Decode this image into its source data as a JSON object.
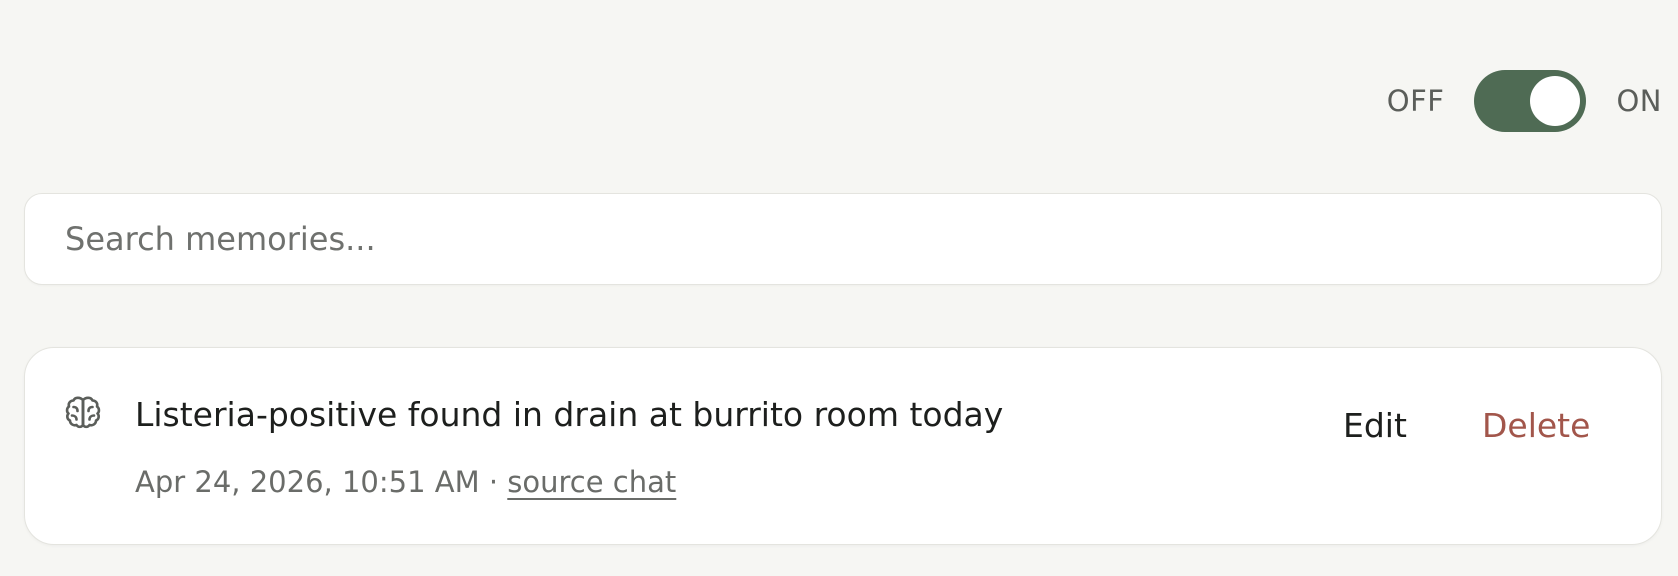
{
  "memory_toggle": {
    "off_label": "OFF",
    "on_label": "ON",
    "state": "on",
    "track_color": "#4f6b54"
  },
  "search": {
    "placeholder": "Search memories...",
    "value": ""
  },
  "memories": [
    {
      "icon": "brain-icon",
      "text": "Listeria-positive found in drain at burrito room today",
      "timestamp": "Apr 24, 2026, 10:51 AM",
      "separator": " · ",
      "source_label": "source chat",
      "edit_label": "Edit",
      "delete_label": "Delete",
      "delete_color": "#a2564b"
    }
  ]
}
